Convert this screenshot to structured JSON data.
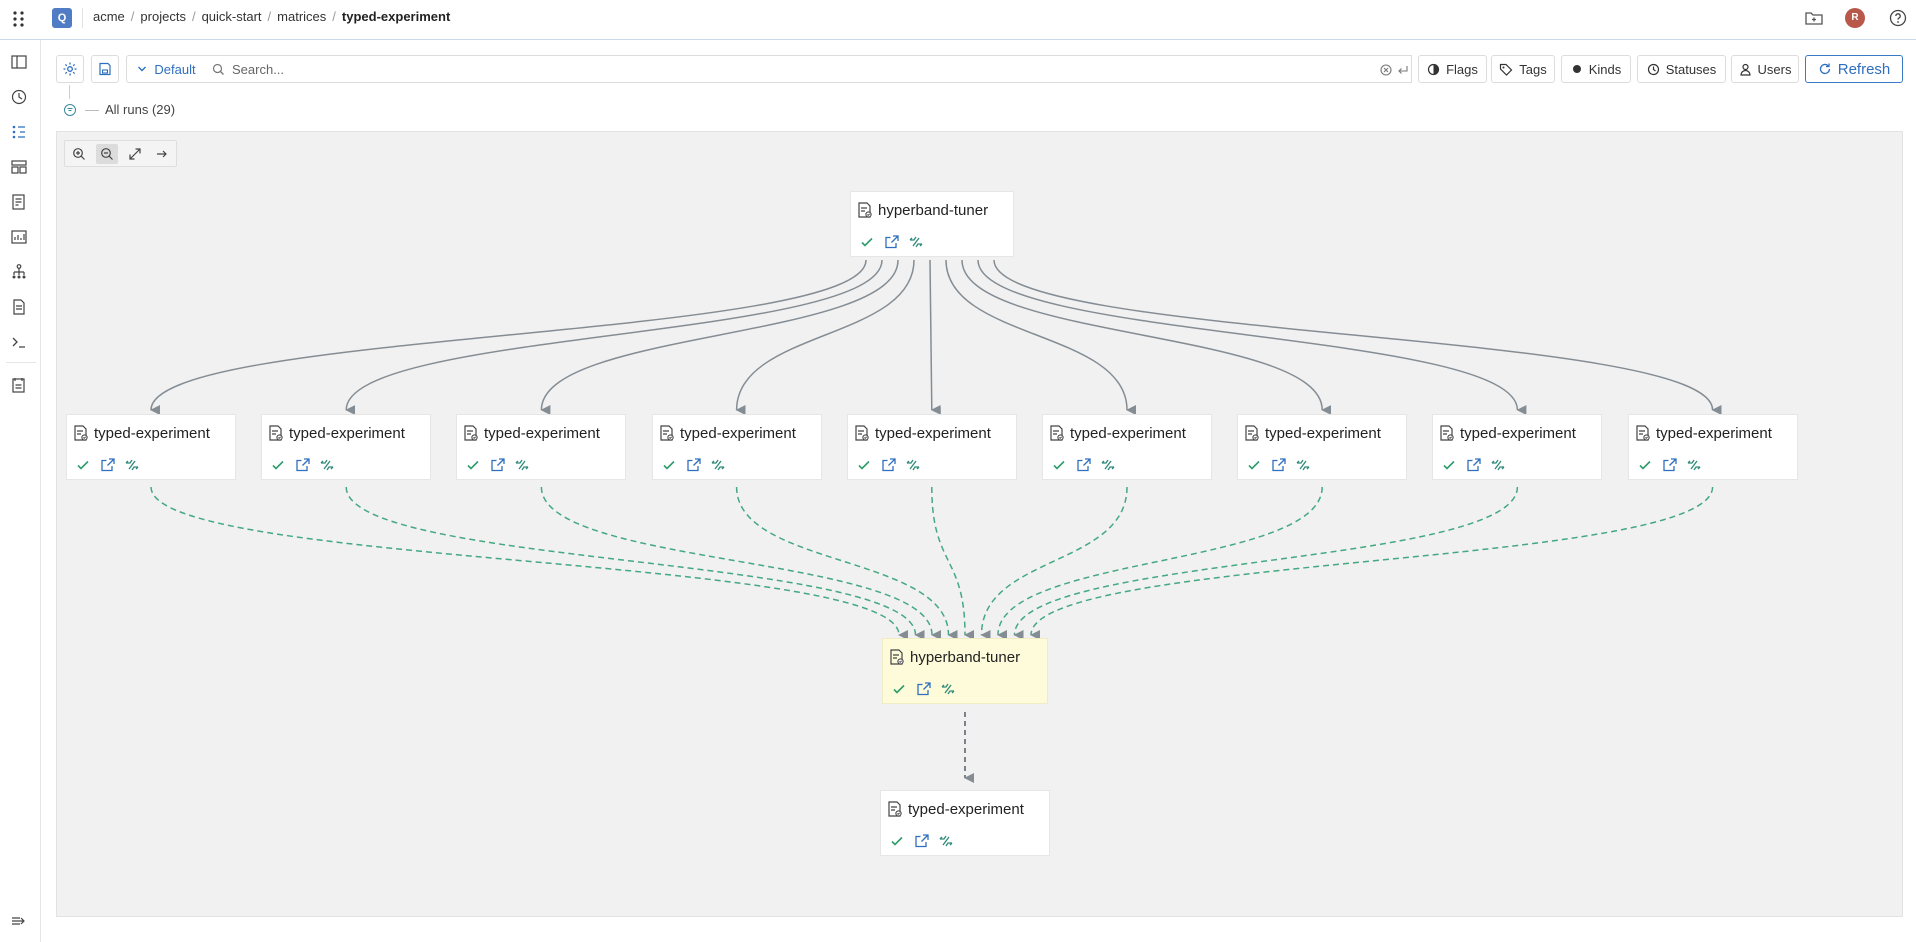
{
  "header": {
    "logo": "Q",
    "breadcrumb": [
      "acme",
      "projects",
      "quick-start",
      "matrices",
      "typed-experiment"
    ],
    "avatar": "R"
  },
  "toolbar": {
    "preset_label": "Default",
    "search_placeholder": "Search...",
    "filters": [
      "Flags",
      "Tags",
      "Kinds",
      "Statuses",
      "Users"
    ],
    "refresh_label": "Refresh"
  },
  "runs": {
    "label": "All runs (29)"
  },
  "graph": {
    "top_node": {
      "title": "hyperband-tuner",
      "status": "succeeded"
    },
    "children": [
      {
        "title": "typed-experiment",
        "status": "succeeded"
      },
      {
        "title": "typed-experiment",
        "status": "succeeded"
      },
      {
        "title": "typed-experiment",
        "status": "succeeded"
      },
      {
        "title": "typed-experiment",
        "status": "succeeded"
      },
      {
        "title": "typed-experiment",
        "status": "succeeded"
      },
      {
        "title": "typed-experiment",
        "status": "succeeded"
      },
      {
        "title": "typed-experiment",
        "status": "succeeded"
      },
      {
        "title": "typed-experiment",
        "status": "succeeded"
      },
      {
        "title": "typed-experiment",
        "status": "succeeded"
      }
    ],
    "merge_node": {
      "title": "hyperband-tuner",
      "status": "succeeded",
      "highlighted": true
    },
    "final_node": {
      "title": "typed-experiment",
      "status": "succeeded"
    }
  },
  "colors": {
    "accent": "#2f6fbf",
    "success": "#2e9c6a",
    "edge_solid": "#858d94",
    "edge_dashed": "#45a882",
    "highlight": "#fdfbd9"
  }
}
